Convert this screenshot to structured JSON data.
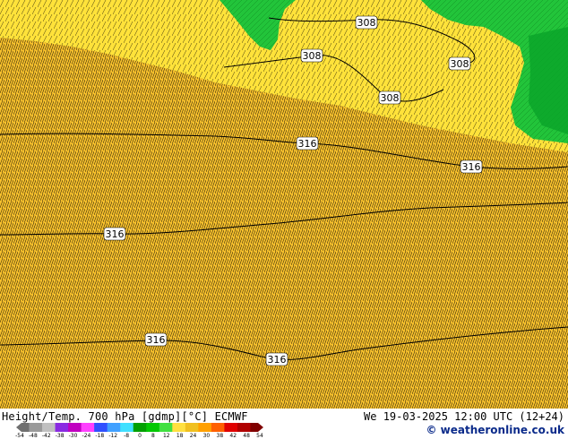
{
  "map": {
    "fill_colors": {
      "main": "#f9c22d",
      "light": "#ffe23a",
      "green": "#22c43a",
      "dark_green": "#0aa62a",
      "pattern": "#000000"
    },
    "contour_labels": [
      "308",
      "308",
      "308",
      "308",
      "316",
      "316",
      "316",
      "316",
      "316"
    ]
  },
  "footer": {
    "title": "Height/Temp. 700 hPa [gdmp][°C] ECMWF",
    "datetime": "We 19-03-2025 12:00 UTC (12+24)",
    "credit": "© weatheronline.co.uk"
  },
  "legend": {
    "ticks": [
      "-54",
      "-48",
      "-42",
      "-38",
      "-30",
      "-24",
      "-18",
      "-12",
      "-8",
      "0",
      "8",
      "12",
      "18",
      "24",
      "30",
      "38",
      "42",
      "48",
      "54"
    ],
    "colors": [
      "#6f6f6f",
      "#9a9a9a",
      "#c0c0c0",
      "#8a2be2",
      "#c000c0",
      "#ff40ff",
      "#3050ff",
      "#40a0ff",
      "#40e0ff",
      "#00a000",
      "#00c800",
      "#40e040",
      "#ffe040",
      "#f0c020",
      "#ffa000",
      "#ff6000",
      "#e00000",
      "#b00000",
      "#800000"
    ]
  }
}
